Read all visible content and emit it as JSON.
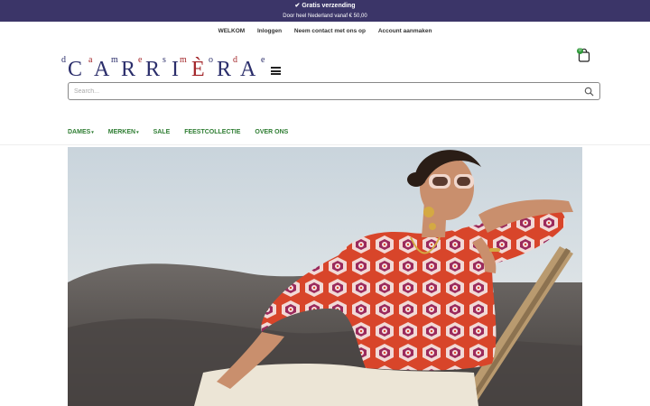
{
  "promo": {
    "check_icon": "check-icon",
    "headline": "Gratis verzending",
    "subline": "Door heel Nederland vanaf € 50,00"
  },
  "top_links": [
    "WELKOM",
    "Inloggen",
    "Neem contact met ons op",
    "Account aanmaken"
  ],
  "logo": {
    "small_letters": [
      "d",
      "a",
      "m",
      "e",
      "s",
      "m",
      "o",
      "d",
      "e"
    ],
    "big_letters": [
      "C",
      "A",
      "R",
      "R",
      "I",
      "È",
      "R",
      "A"
    ],
    "colors": {
      "brand_blue": "#2b2e6b",
      "brand_red": "#a3262a"
    }
  },
  "cart": {
    "count": "0",
    "icon": "shopping-bag-icon"
  },
  "search": {
    "placeholder": "Search...",
    "value": "",
    "icon": "search-icon"
  },
  "nav": [
    {
      "label": "DAMES",
      "has_dropdown": true
    },
    {
      "label": "MERKEN",
      "has_dropdown": true
    },
    {
      "label": "SALE",
      "has_dropdown": false
    },
    {
      "label": "FEESTCOLLECTIE",
      "has_dropdown": false
    },
    {
      "label": "OVER ONS",
      "has_dropdown": false
    }
  ],
  "colors": {
    "promo_bg": "#3b3568",
    "nav_green": "#2e7d32",
    "badge_green": "#2f9a3a"
  },
  "chevron_glyph": "▾"
}
